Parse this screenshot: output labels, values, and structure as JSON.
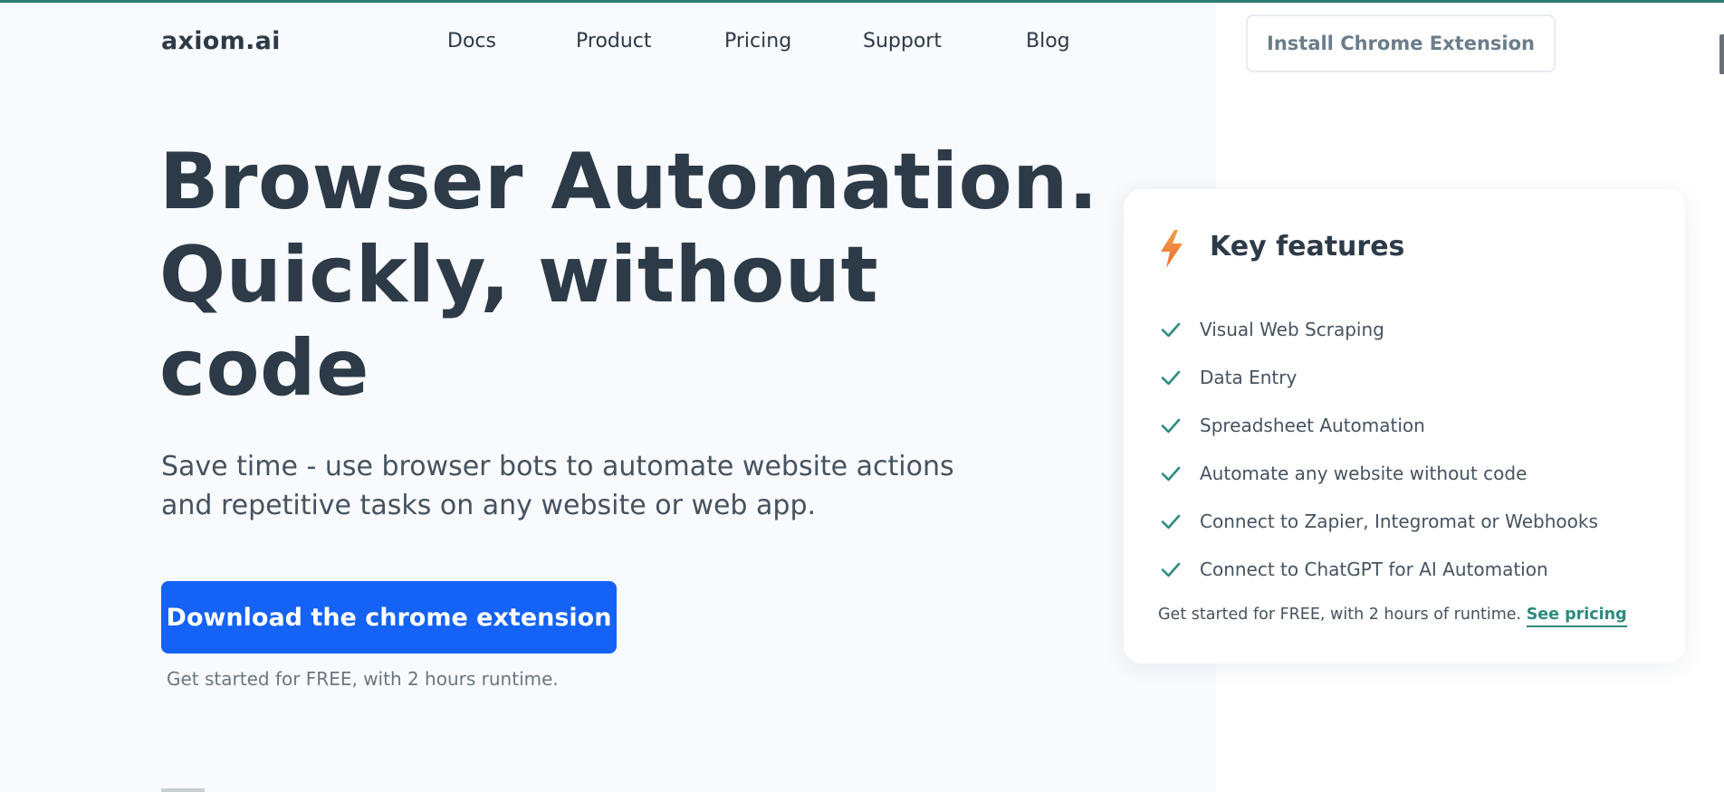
{
  "nav": {
    "logo": "axiom.ai",
    "links": [
      {
        "label": "Docs"
      },
      {
        "label": "Product"
      },
      {
        "label": "Pricing"
      },
      {
        "label": "Support"
      },
      {
        "label": "Blog"
      }
    ],
    "install_button": "Install Chrome Extension"
  },
  "hero": {
    "title_lines": [
      "Browser Automation.",
      "Quickly, without",
      "code"
    ],
    "subtitle": "Save time - use browser bots to automate website actions and repetitive tasks on any website or web app.",
    "cta_button": "Download the chrome extension",
    "cta_note": "Get started for FREE, with 2 hours runtime."
  },
  "features_card": {
    "icon": "lightning-bolt-icon",
    "title": "Key features",
    "items": [
      {
        "label": "Visual Web Scraping",
        "icon": "check-icon"
      },
      {
        "label": "Data Entry",
        "icon": "check-icon"
      },
      {
        "label": "Spreadsheet Automation",
        "icon": "check-icon"
      },
      {
        "label": "Automate any website without code",
        "icon": "check-icon"
      },
      {
        "label": "Connect to Zapier, Integromat or Webhooks",
        "icon": "check-icon"
      },
      {
        "label": "Connect to ChatGPT for AI Automation",
        "icon": "check-icon"
      }
    ],
    "footer_text": "Get started for FREE, with 2 hours of runtime.",
    "footer_link": "See pricing"
  },
  "colors": {
    "primary_button": "#1462f6",
    "text_dark": "#2d3a47",
    "accent_teal": "#2e8a7e",
    "bolt_orange": "#f5823b"
  }
}
